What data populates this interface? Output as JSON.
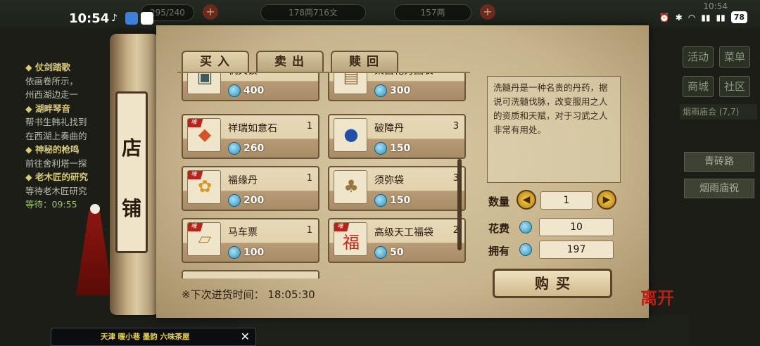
{
  "status_bar": {
    "time": "10:54",
    "battery": "78",
    "bg_time": "10:54"
  },
  "hud": {
    "stamina": "295/240",
    "copper": "178两716文",
    "silver": "157两"
  },
  "quests": [
    {
      "title": "◆ 仗剑踏歌",
      "lines": [
        "依画卷所示，",
        "州西湖边走一"
      ]
    },
    {
      "title": "◆ 湖畔琴音",
      "lines": [
        "帮书生韩礼找到",
        "在西湖上奏曲的"
      ]
    },
    {
      "title": "◆ 神秘的枪鸣",
      "lines": [
        "前往舍利塔一探"
      ]
    },
    {
      "title": "◆ 老木匠的研究",
      "lines": [
        "等待老木匠研究"
      ],
      "wait": "等待：09:55"
    }
  ],
  "right_menu": {
    "activity": "活动",
    "menu": "菜单",
    "mall": "商城",
    "community": "社区",
    "location_bar": "烟雨庙会 (7,7)",
    "road1": "青砖路",
    "road2": "烟雨庙祝"
  },
  "shop": {
    "roll_title": [
      "店",
      "铺"
    ],
    "tabs": [
      "买入",
      "卖出",
      "赎回"
    ],
    "items": [
      {
        "name": "机关锁",
        "qty": "",
        "price": "400",
        "icon": "lock-box-icon"
      },
      {
        "name": "莱茵花刃图袋",
        "qty": "",
        "price": "300",
        "icon": "scroll-icon"
      },
      {
        "name": "祥瑞如意石",
        "qty": "1",
        "price": "260",
        "icon": "gem-stone-icon"
      },
      {
        "name": "破障丹",
        "qty": "3",
        "price": "150",
        "icon": "blue-pill-icon"
      },
      {
        "name": "福缘丹",
        "qty": "1",
        "price": "200",
        "icon": "lucky-pouch-icon"
      },
      {
        "name": "须弥袋",
        "qty": "3",
        "price": "150",
        "icon": "sack-icon"
      },
      {
        "name": "马车票",
        "qty": "1",
        "price": "100",
        "icon": "ticket-icon"
      },
      {
        "name": "高级天工福袋",
        "qty": "2",
        "price": "50",
        "icon": "red-fortune-bag-icon"
      }
    ],
    "restock_label": "※下次进货时间：",
    "restock_time": "18:05:30",
    "description": "洗髓丹是一种名贵的丹药，据说可洗髓伐脉，改变服用之人的资质和天赋，对于习武之人非常有用处。",
    "quantity_label": "数量",
    "quantity": "1",
    "cost_label": "花费",
    "cost": "10",
    "owned_label": "拥有",
    "owned": "197",
    "buy_label": "购买"
  },
  "float_window": {
    "text": "天津 暖小巷 墨韵 六味茶屋"
  },
  "seal": "离开",
  "colors": {
    "paper": "#d7c7a2",
    "ribbon": "#b8231a",
    "coin": "#2f8fb9",
    "tassel": "#8e1610"
  }
}
